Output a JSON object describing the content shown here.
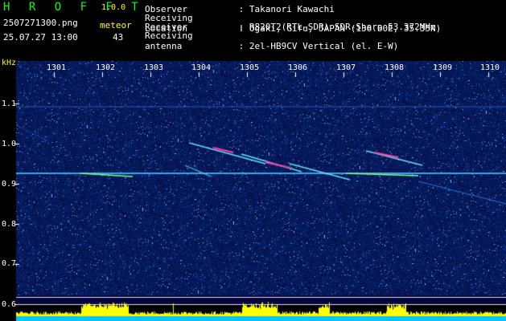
{
  "app": {
    "title": "H R O F F T",
    "version": "1.0.0"
  },
  "file": {
    "name": "2507271300.png",
    "datetime": "25.07.27 13:00"
  },
  "meteor": {
    "label": "meteor",
    "count": "43"
  },
  "info": [
    {
      "key": "Observer",
      "sep": ":",
      "value": "Takanori Kawachi"
    },
    {
      "key": "Receiving Location",
      "sep": ":",
      "value": "Ogaki, Gifu, JAPAN (136.60E, 35.35N)"
    },
    {
      "key": "Receiver",
      "sep": ":",
      "value": "R820T2(RTL-SDR) SDR-Sharp 53.372MHz"
    },
    {
      "key": "Receiving antenna",
      "sep": ":",
      "value": "2el-HB9CV Vertical (el. E-W)"
    }
  ],
  "axes": {
    "y_unit": "kHz",
    "x_ticks": [
      "1301",
      "1302",
      "1303",
      "1304",
      "1305",
      "1306",
      "1307",
      "1308",
      "1309",
      "1310"
    ],
    "y_ticks": [
      "1.1",
      "1.0",
      "0.9",
      "0.8",
      "0.7",
      "0.6"
    ]
  },
  "colors": {
    "background": "#0a0a5a",
    "title": "#00ff00",
    "accent": "#ffff00",
    "carrier": "#40c0ff",
    "meteor_trail": "#ff40a0",
    "histogram_fill": "#ffff00",
    "baseline": "#00c8ff"
  }
}
